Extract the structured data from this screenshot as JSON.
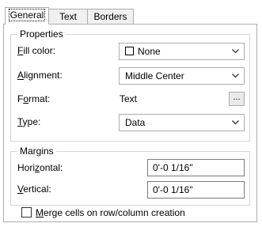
{
  "tabs": [
    {
      "label": "General",
      "active": true
    },
    {
      "label": "Text",
      "active": false
    },
    {
      "label": "Borders",
      "active": false
    }
  ],
  "properties": {
    "legend": "Properties",
    "fill_color": {
      "label_key": "F",
      "label_rest": "ill color:",
      "value": "None"
    },
    "alignment": {
      "label_key": "A",
      "label_rest": "lignment:",
      "value": "Middle Center"
    },
    "format": {
      "label_pre": "F",
      "label_key": "o",
      "label_rest": "rmat:",
      "value": "Text",
      "button": "..."
    },
    "type": {
      "label_key": "T",
      "label_rest": "ype:",
      "value": "Data"
    }
  },
  "margins": {
    "legend": "Margins",
    "horizontal": {
      "label_pre": "Hori",
      "label_key": "z",
      "label_rest": "ontal:",
      "value": "0'-0 1/16\""
    },
    "vertical": {
      "label_key": "V",
      "label_rest": "ertical:",
      "value": "0'-0 1/16\""
    }
  },
  "merge_checkbox": {
    "label_key": "M",
    "label_rest": "erge cells on row/column creation",
    "checked": false
  },
  "icons": {
    "dropdown": "chevron-down-icon",
    "swatch": "color-swatch-icon"
  },
  "colors": {
    "border": "#adadad",
    "group_border": "#d5d5d5",
    "background": "#ffffff"
  }
}
